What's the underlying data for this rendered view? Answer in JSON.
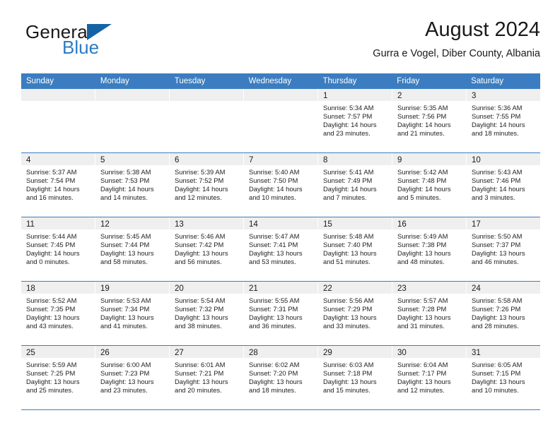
{
  "brand": {
    "name_part1": "General",
    "name_part2": "Blue",
    "triangle_color": "#1464a5",
    "blue_color": "#2b7cc4"
  },
  "header": {
    "title": "August 2024",
    "subtitle": "Gurra e Vogel, Diber County, Albania"
  },
  "calendar": {
    "header_bg": "#3b7dc0",
    "daynum_bg": "#efefef",
    "weekdays": [
      "Sunday",
      "Monday",
      "Tuesday",
      "Wednesday",
      "Thursday",
      "Friday",
      "Saturday"
    ],
    "weeks": [
      [
        {
          "day": "",
          "empty": true
        },
        {
          "day": "",
          "empty": true
        },
        {
          "day": "",
          "empty": true
        },
        {
          "day": "",
          "empty": true
        },
        {
          "day": "1",
          "sunrise": "Sunrise: 5:34 AM",
          "sunset": "Sunset: 7:57 PM",
          "daylight_line1": "Daylight: 14 hours",
          "daylight_line2": "and 23 minutes."
        },
        {
          "day": "2",
          "sunrise": "Sunrise: 5:35 AM",
          "sunset": "Sunset: 7:56 PM",
          "daylight_line1": "Daylight: 14 hours",
          "daylight_line2": "and 21 minutes."
        },
        {
          "day": "3",
          "sunrise": "Sunrise: 5:36 AM",
          "sunset": "Sunset: 7:55 PM",
          "daylight_line1": "Daylight: 14 hours",
          "daylight_line2": "and 18 minutes."
        }
      ],
      [
        {
          "day": "4",
          "sunrise": "Sunrise: 5:37 AM",
          "sunset": "Sunset: 7:54 PM",
          "daylight_line1": "Daylight: 14 hours",
          "daylight_line2": "and 16 minutes."
        },
        {
          "day": "5",
          "sunrise": "Sunrise: 5:38 AM",
          "sunset": "Sunset: 7:53 PM",
          "daylight_line1": "Daylight: 14 hours",
          "daylight_line2": "and 14 minutes."
        },
        {
          "day": "6",
          "sunrise": "Sunrise: 5:39 AM",
          "sunset": "Sunset: 7:52 PM",
          "daylight_line1": "Daylight: 14 hours",
          "daylight_line2": "and 12 minutes."
        },
        {
          "day": "7",
          "sunrise": "Sunrise: 5:40 AM",
          "sunset": "Sunset: 7:50 PM",
          "daylight_line1": "Daylight: 14 hours",
          "daylight_line2": "and 10 minutes."
        },
        {
          "day": "8",
          "sunrise": "Sunrise: 5:41 AM",
          "sunset": "Sunset: 7:49 PM",
          "daylight_line1": "Daylight: 14 hours",
          "daylight_line2": "and 7 minutes."
        },
        {
          "day": "9",
          "sunrise": "Sunrise: 5:42 AM",
          "sunset": "Sunset: 7:48 PM",
          "daylight_line1": "Daylight: 14 hours",
          "daylight_line2": "and 5 minutes."
        },
        {
          "day": "10",
          "sunrise": "Sunrise: 5:43 AM",
          "sunset": "Sunset: 7:46 PM",
          "daylight_line1": "Daylight: 14 hours",
          "daylight_line2": "and 3 minutes."
        }
      ],
      [
        {
          "day": "11",
          "sunrise": "Sunrise: 5:44 AM",
          "sunset": "Sunset: 7:45 PM",
          "daylight_line1": "Daylight: 14 hours",
          "daylight_line2": "and 0 minutes."
        },
        {
          "day": "12",
          "sunrise": "Sunrise: 5:45 AM",
          "sunset": "Sunset: 7:44 PM",
          "daylight_line1": "Daylight: 13 hours",
          "daylight_line2": "and 58 minutes."
        },
        {
          "day": "13",
          "sunrise": "Sunrise: 5:46 AM",
          "sunset": "Sunset: 7:42 PM",
          "daylight_line1": "Daylight: 13 hours",
          "daylight_line2": "and 56 minutes."
        },
        {
          "day": "14",
          "sunrise": "Sunrise: 5:47 AM",
          "sunset": "Sunset: 7:41 PM",
          "daylight_line1": "Daylight: 13 hours",
          "daylight_line2": "and 53 minutes."
        },
        {
          "day": "15",
          "sunrise": "Sunrise: 5:48 AM",
          "sunset": "Sunset: 7:40 PM",
          "daylight_line1": "Daylight: 13 hours",
          "daylight_line2": "and 51 minutes."
        },
        {
          "day": "16",
          "sunrise": "Sunrise: 5:49 AM",
          "sunset": "Sunset: 7:38 PM",
          "daylight_line1": "Daylight: 13 hours",
          "daylight_line2": "and 48 minutes."
        },
        {
          "day": "17",
          "sunrise": "Sunrise: 5:50 AM",
          "sunset": "Sunset: 7:37 PM",
          "daylight_line1": "Daylight: 13 hours",
          "daylight_line2": "and 46 minutes."
        }
      ],
      [
        {
          "day": "18",
          "sunrise": "Sunrise: 5:52 AM",
          "sunset": "Sunset: 7:35 PM",
          "daylight_line1": "Daylight: 13 hours",
          "daylight_line2": "and 43 minutes."
        },
        {
          "day": "19",
          "sunrise": "Sunrise: 5:53 AM",
          "sunset": "Sunset: 7:34 PM",
          "daylight_line1": "Daylight: 13 hours",
          "daylight_line2": "and 41 minutes."
        },
        {
          "day": "20",
          "sunrise": "Sunrise: 5:54 AM",
          "sunset": "Sunset: 7:32 PM",
          "daylight_line1": "Daylight: 13 hours",
          "daylight_line2": "and 38 minutes."
        },
        {
          "day": "21",
          "sunrise": "Sunrise: 5:55 AM",
          "sunset": "Sunset: 7:31 PM",
          "daylight_line1": "Daylight: 13 hours",
          "daylight_line2": "and 36 minutes."
        },
        {
          "day": "22",
          "sunrise": "Sunrise: 5:56 AM",
          "sunset": "Sunset: 7:29 PM",
          "daylight_line1": "Daylight: 13 hours",
          "daylight_line2": "and 33 minutes."
        },
        {
          "day": "23",
          "sunrise": "Sunrise: 5:57 AM",
          "sunset": "Sunset: 7:28 PM",
          "daylight_line1": "Daylight: 13 hours",
          "daylight_line2": "and 31 minutes."
        },
        {
          "day": "24",
          "sunrise": "Sunrise: 5:58 AM",
          "sunset": "Sunset: 7:26 PM",
          "daylight_line1": "Daylight: 13 hours",
          "daylight_line2": "and 28 minutes."
        }
      ],
      [
        {
          "day": "25",
          "sunrise": "Sunrise: 5:59 AM",
          "sunset": "Sunset: 7:25 PM",
          "daylight_line1": "Daylight: 13 hours",
          "daylight_line2": "and 25 minutes."
        },
        {
          "day": "26",
          "sunrise": "Sunrise: 6:00 AM",
          "sunset": "Sunset: 7:23 PM",
          "daylight_line1": "Daylight: 13 hours",
          "daylight_line2": "and 23 minutes."
        },
        {
          "day": "27",
          "sunrise": "Sunrise: 6:01 AM",
          "sunset": "Sunset: 7:21 PM",
          "daylight_line1": "Daylight: 13 hours",
          "daylight_line2": "and 20 minutes."
        },
        {
          "day": "28",
          "sunrise": "Sunrise: 6:02 AM",
          "sunset": "Sunset: 7:20 PM",
          "daylight_line1": "Daylight: 13 hours",
          "daylight_line2": "and 18 minutes."
        },
        {
          "day": "29",
          "sunrise": "Sunrise: 6:03 AM",
          "sunset": "Sunset: 7:18 PM",
          "daylight_line1": "Daylight: 13 hours",
          "daylight_line2": "and 15 minutes."
        },
        {
          "day": "30",
          "sunrise": "Sunrise: 6:04 AM",
          "sunset": "Sunset: 7:17 PM",
          "daylight_line1": "Daylight: 13 hours",
          "daylight_line2": "and 12 minutes."
        },
        {
          "day": "31",
          "sunrise": "Sunrise: 6:05 AM",
          "sunset": "Sunset: 7:15 PM",
          "daylight_line1": "Daylight: 13 hours",
          "daylight_line2": "and 10 minutes."
        }
      ]
    ]
  }
}
